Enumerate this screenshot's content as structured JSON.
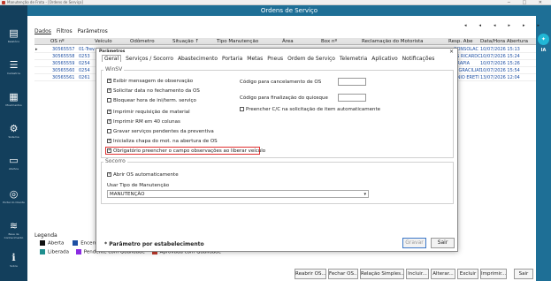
{
  "window": {
    "title": "Manutenção de Frota - [Ordens de Serviço]"
  },
  "header": {
    "title": "Ordens de Serviço"
  },
  "sidebar": {
    "items": [
      {
        "label": "Relatório",
        "glyph": "▤"
      },
      {
        "label": "Cadastros",
        "glyph": "☰"
      },
      {
        "label": "Movimentos",
        "glyph": "▦"
      },
      {
        "label": "Sistema",
        "glyph": "⚙"
      },
      {
        "label": "Atalhos",
        "glyph": "▭"
      },
      {
        "label": "Portal do Cliente",
        "glyph": "◎"
      },
      {
        "label": "Base de Conhecimento",
        "glyph": "≋"
      },
      {
        "label": "Sobre",
        "glyph": "ℹ"
      }
    ]
  },
  "rightbar": {
    "ia_label": "IA"
  },
  "main_tabs": [
    "Dados",
    "Filtros",
    "Parâmetros"
  ],
  "grid": {
    "columns": [
      "OS nº",
      "Veículo",
      "Odômetro",
      "Situação ↑",
      "Tipo Manutenção",
      "Área",
      "Box nº",
      "Reclamação do Motorista",
      "Resp. Abe",
      "Data/Hora Abertura"
    ],
    "rows": [
      {
        "os": "30565557",
        "veiculo": "01-Trev",
        "resp": "CONSOLAC",
        "data": "10/07/2026 15:13"
      },
      {
        "os": "30565558",
        "veiculo": "0253",
        "resp": "ES RICARDO",
        "data": "10/07/2026 15:24"
      },
      {
        "os": "30565559",
        "veiculo": "0254",
        "resp": "ARAPIA",
        "data": "10/07/2026 15:26"
      },
      {
        "os": "30565560",
        "veiculo": "0254",
        "resp": "O GRACILIAN",
        "data": "10/07/2026 15:54"
      },
      {
        "os": "30565561",
        "veiculo": "0261",
        "resp": "UNIO ERETI",
        "data": "13/07/2026 12:04"
      }
    ]
  },
  "legend": {
    "title": "Legenda",
    "items": [
      {
        "label": "Aberta",
        "color": "#111111"
      },
      {
        "label": "Encerrada",
        "color": "#1d4fa3"
      },
      {
        "label": "Liberada",
        "color": "#1f8f8f"
      },
      {
        "label": "Pendente com Qualidade",
        "color": "#8a2be2"
      },
      {
        "label": "Aprovada com Qualidade",
        "color": "#c0392b"
      }
    ]
  },
  "footer_buttons": [
    "Reabrir OS...",
    "Fechar OS...",
    "Relação Simples...",
    "Incluir...",
    "Alterar...",
    "Excluir",
    "Imprimir...",
    "Sair"
  ],
  "modal": {
    "title": "Parâmetros",
    "tabs": [
      "Geral",
      "Serviços / Socorro",
      "Abastecimento",
      "Portaria",
      "Metas",
      "Pneus",
      "Ordem de Serviço",
      "Telemetria",
      "Aplicativo",
      "Notificações"
    ],
    "winsv": {
      "title": "WinSV",
      "checks": [
        {
          "label": "Exibir mensagem de observação",
          "checked": true
        },
        {
          "label": "Solicitar data no fechamento da OS",
          "checked": true
        },
        {
          "label": "Bloquear hora de ini/term. serviço",
          "checked": false
        },
        {
          "label": "Imprimir requisição de material",
          "checked": true
        },
        {
          "label": "Imprimir RM em 40 colunas",
          "checked": true
        },
        {
          "label": "Gravar serviços pendentes da preventiva",
          "checked": false
        },
        {
          "label": "Inicializa chapa do mot. na abertura de OS",
          "checked": true
        },
        {
          "label": "Obrigatório preencher o campo observações ao liberar veículo",
          "checked": true
        }
      ],
      "field_cancel": "Código para cancelamento de OS",
      "field_finalize": "Código para finalização do quiosque",
      "check_cc": {
        "label": "Preencher C/C na solicitação de item automaticamente",
        "checked": false
      }
    },
    "socorro": {
      "title": "Socorro",
      "check_abrir": {
        "label": "Abrir OS automaticamente",
        "checked": true
      },
      "tipo_label": "Usar Tipo de Manutenção",
      "tipo_value": "MANUTENÇÃO"
    },
    "note": "* Parâmetro por estabelecimento",
    "save": "Gravar",
    "exit": "Sair"
  }
}
